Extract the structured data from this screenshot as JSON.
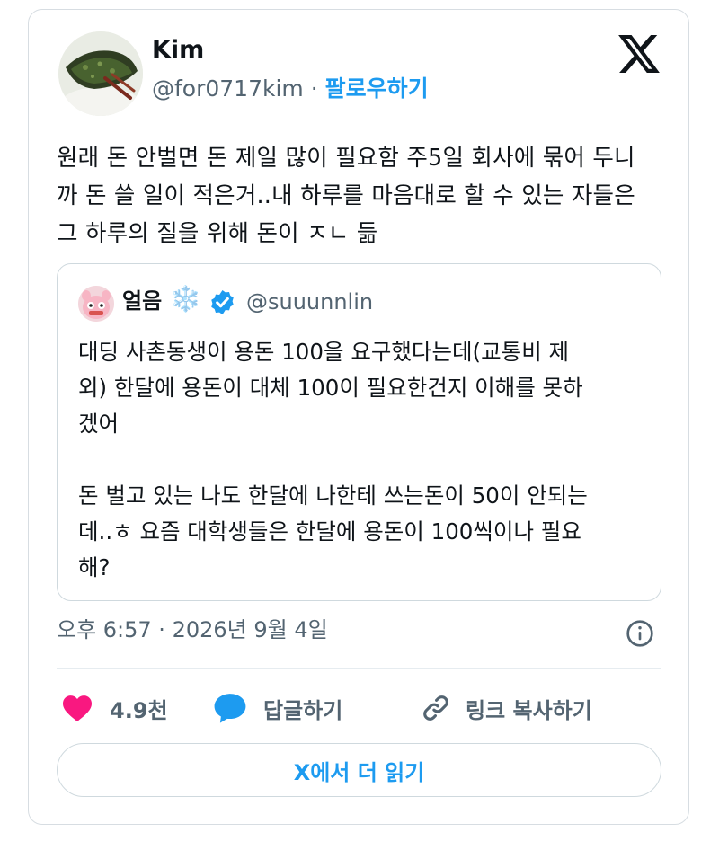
{
  "author": {
    "name": "Kim",
    "handle": "@for0717kim",
    "separator": "·",
    "follow_label": "팔로우하기"
  },
  "brand": {
    "logo_icon": "x-logo-icon"
  },
  "tweet": {
    "lines": [
      "원래 돈 안벌면 돈 제일 많이 필요함 주5일 회사에 묶어 두니",
      "까 돈 쓸 일이 적은거..내 하루를 마음대로 할 수 있는 자들은",
      "그 하루의 질을 위해 돈이 ㅈㄴ 듦"
    ]
  },
  "quote": {
    "name": "얼음",
    "name_emoji": "❄️",
    "handle": "@suuunnlin",
    "verified_icon": "verified-badge-icon",
    "lines": [
      "대딩 사촌동생이 용돈 100을 요구했다는데(교통비 제",
      "외) 한달에 용돈이 대체 100이 필요한건지 이해를 못하",
      "겠어",
      "",
      "돈 벌고 있는 나도 한달에 나한테 쓰는돈이 50이 안되는",
      "데..ㅎ 요즘 대학생들은 한달에 용돈이 100씩이나 필요",
      "해?"
    ]
  },
  "meta": {
    "timestamp": "오후 6:57 · 2026년 9월 4일",
    "info_icon": "info-icon"
  },
  "actions": {
    "like_count": "4.9천",
    "reply_label": "답글하기",
    "copy_link_label": "링크 복사하기"
  },
  "footer": {
    "read_more_label": "X에서 더 읽기"
  },
  "colors": {
    "accent": "#1d9bf0",
    "like": "#f91880",
    "secondary_text": "#536471",
    "border": "#cfd9de"
  }
}
